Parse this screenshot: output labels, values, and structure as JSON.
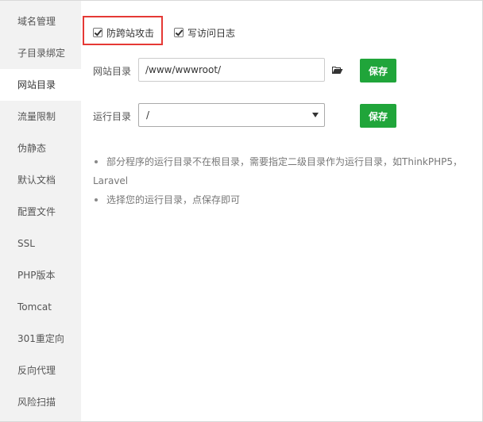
{
  "sidebar": {
    "items": [
      {
        "label": "域名管理"
      },
      {
        "label": "子目录绑定"
      },
      {
        "label": "网站目录",
        "active": true
      },
      {
        "label": "流量限制"
      },
      {
        "label": "伪静态"
      },
      {
        "label": "默认文档"
      },
      {
        "label": "配置文件"
      },
      {
        "label": "SSL"
      },
      {
        "label": "PHP版本"
      },
      {
        "label": "Tomcat"
      },
      {
        "label": "301重定向"
      },
      {
        "label": "反向代理"
      },
      {
        "label": "风险扫描"
      }
    ]
  },
  "options": {
    "anti_xss": {
      "label": "防跨站攻击",
      "checked": true
    },
    "access_log": {
      "label": "写访问日志",
      "checked": true
    }
  },
  "site_dir": {
    "label": "网站目录",
    "value": "/www/wwwroot/",
    "icon": "folder-open-icon",
    "save_label": "保存"
  },
  "run_dir": {
    "label": "运行目录",
    "selected": "/",
    "save_label": "保存"
  },
  "tips": {
    "line1": "部分程序的运行目录不在根目录，需要指定二级目录作为运行目录，如ThinkPHP5，",
    "line1b": "Laravel",
    "line2": "选择您的运行目录，点保存即可"
  },
  "colors": {
    "accent": "#20a53a",
    "highlight": "#e53935",
    "sidebar_bg": "#f2f2f2"
  }
}
